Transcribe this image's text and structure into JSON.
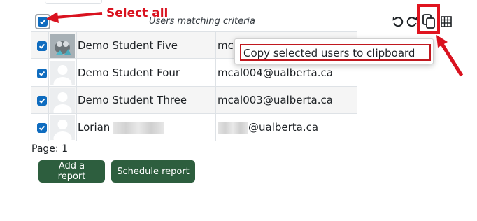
{
  "annotation": {
    "select_all_label": "Select all",
    "accent_color": "#e0141f"
  },
  "report": {
    "caption": "Users matching criteria",
    "tool_icons": [
      "undo-icon",
      "redo-icon",
      "copy-icon",
      "table-icon"
    ]
  },
  "table": {
    "rows": [
      {
        "name": "Demo Student Five",
        "email": "mc",
        "checked": true,
        "avatar": "cat-photo"
      },
      {
        "name": "Demo Student Four",
        "email": "mcal004@ualberta.ca",
        "checked": true,
        "avatar": "default-user"
      },
      {
        "name": "Demo Student Three",
        "email": "mcal003@ualberta.ca",
        "checked": true,
        "avatar": "default-user"
      },
      {
        "name": "Lorian",
        "email": "@ualberta.ca",
        "checked": true,
        "avatar": "default-user"
      }
    ]
  },
  "pagination": {
    "label": "Page:",
    "page": "1"
  },
  "buttons": {
    "add_report": "Add a report",
    "schedule_report": "Schedule report"
  },
  "tooltip": {
    "text": "Copy selected users to clipboard"
  }
}
